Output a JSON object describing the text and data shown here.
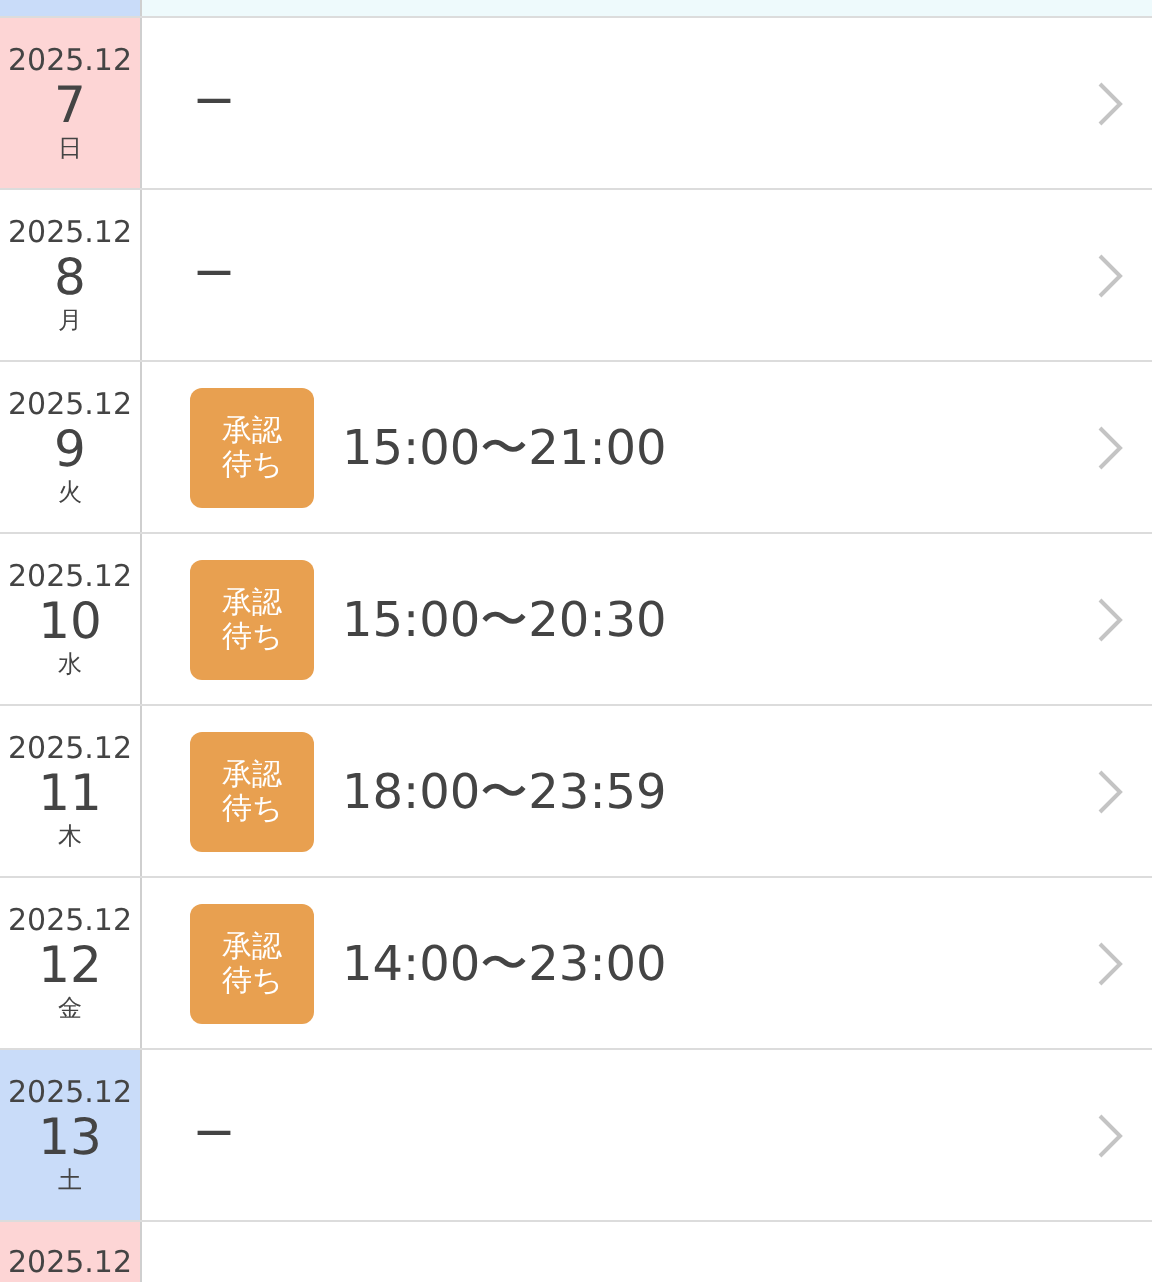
{
  "previous_row": {
    "color": "#c9dcf9",
    "highlighted": true
  },
  "rows": [
    {
      "month": "2025.12",
      "day": "7",
      "weekday": "日",
      "color": "#fdd5d5",
      "status": null,
      "time": "ー"
    },
    {
      "month": "2025.12",
      "day": "8",
      "weekday": "月",
      "color": "#ffffff",
      "status": null,
      "time": "ー"
    },
    {
      "month": "2025.12",
      "day": "9",
      "weekday": "火",
      "color": "#ffffff",
      "status": "承認待ち",
      "time": "15:00〜21:00"
    },
    {
      "month": "2025.12",
      "day": "10",
      "weekday": "水",
      "color": "#ffffff",
      "status": "承認待ち",
      "time": "15:00〜20:30"
    },
    {
      "month": "2025.12",
      "day": "11",
      "weekday": "木",
      "color": "#ffffff",
      "status": "承認待ち",
      "time": "18:00〜23:59"
    },
    {
      "month": "2025.12",
      "day": "12",
      "weekday": "金",
      "color": "#ffffff",
      "status": "承認待ち",
      "time": "14:00〜23:00"
    },
    {
      "month": "2025.12",
      "day": "13",
      "weekday": "土",
      "color": "#c9dcf9",
      "status": null,
      "time": "ー"
    }
  ],
  "next_row": {
    "month": "2025.12",
    "color": "#fdd5d5"
  }
}
